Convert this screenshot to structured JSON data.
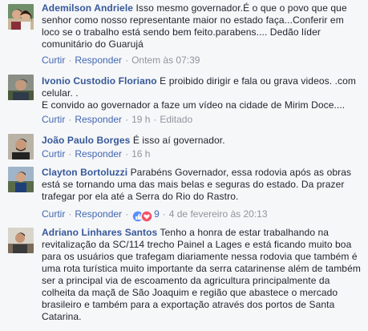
{
  "ui": {
    "like_label": "Curtir",
    "reply_label": "Responder",
    "separator": "·",
    "edited_label": "Editado"
  },
  "comments": [
    {
      "author": "Ademilson Andriele",
      "text": "Isso mesmo governador.É o que o povo que que senhor como nosso representante maior no estado faça...Conferir em loco se o trabalho está sendo bem feito.parabens.... Dedão líder comunitário do Guarujá",
      "time": "Ontem às 07:39"
    },
    {
      "author": "Ivonio Custodio Floriano",
      "text_line1": "E proibido dirigir e fala ou grava videos. .com celular. .",
      "text_line2": "E convido ao governador a faze um vídeo na cidade de Mirim Doce....",
      "time": "19 h"
    },
    {
      "author": "João Paulo Borges",
      "text": "É isso aí governador.",
      "time": "16 h"
    },
    {
      "author": "Clayton Bortoluzzi",
      "text": "Parabéns Governador, essa rodovia após as obras está se tornando uma das mais belas e seguras do estado. Da prazer trafegar por ela até a Serra do Rio do Rastro.",
      "reactions_count": "9",
      "time": "4 de fevereiro às 20:13"
    },
    {
      "author": "Adriano Linhares Santos",
      "text": "Tenho a honra de estar trabalhando na revitalização da SC/114 trecho Painel a Lages e está ficando muito boa para os usuários que trafegam diariamente nessa rodovia que também é uma rota turística muito importante da serra catarinense além de também ser a principal via de escoamento da agricultura principalmente da colheita da maçã de São Joaquim e região que abastece o mercado brasileiro e também para a exportação através dos portos de Santa Catarina."
    }
  ]
}
